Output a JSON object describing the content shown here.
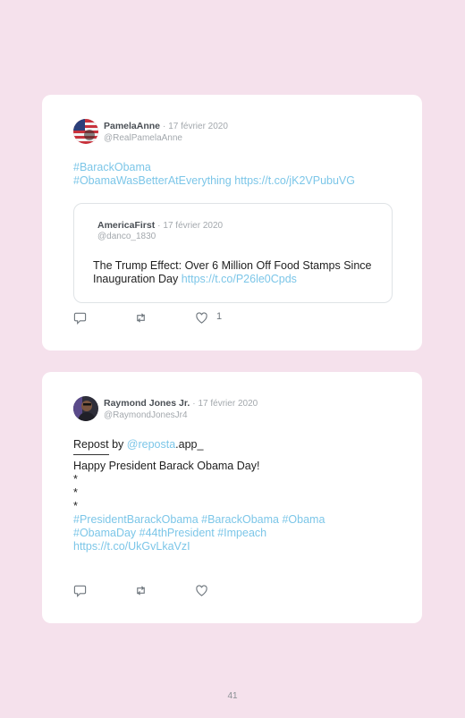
{
  "tweets": [
    {
      "author": {
        "name": "PamelaAnne",
        "handle": "@RealPamelaAnne",
        "avatar_icon": "flag-avatar"
      },
      "date": "17 février 2020",
      "separator": "·",
      "text_lines": [
        "#BarackObama",
        "#ObamaWasBetterAtEverything",
        "https://t.co/jK2VPubuVG"
      ],
      "quote": {
        "author": {
          "name": "AmericaFirst",
          "handle": "@danco_1830"
        },
        "date": "17 février 2020",
        "text": "The Trump Effect: Over 6 Million Off Food Stamps Since Inauguration Day",
        "link": "https://t.co/P26le0Cpds"
      },
      "likes": "1"
    },
    {
      "author": {
        "name": "Raymond Jones Jr.",
        "handle": "@RaymondJonesJr4",
        "avatar_icon": "person-avatar"
      },
      "date": "17 février 2020",
      "separator": "·",
      "repost_prefix": "Repost by ",
      "repost_mention": "@reposta",
      "repost_suffix": ".app_",
      "main_text": "Happy President Barack Obama Day!",
      "stars": [
        "*",
        "*",
        "*"
      ],
      "hashtags_line1": "#PresidentBarackObama #BarackObama #Obama",
      "hashtags_line2": "#ObamaDay #44thPresident #Impeach",
      "link": "https://t.co/UkGvLkaVzI"
    }
  ],
  "page_number": "41",
  "colors": {
    "background": "#f5e1ec",
    "link": "#7cc6e8",
    "name": "#4a4f55",
    "muted": "#a3a8ad"
  }
}
